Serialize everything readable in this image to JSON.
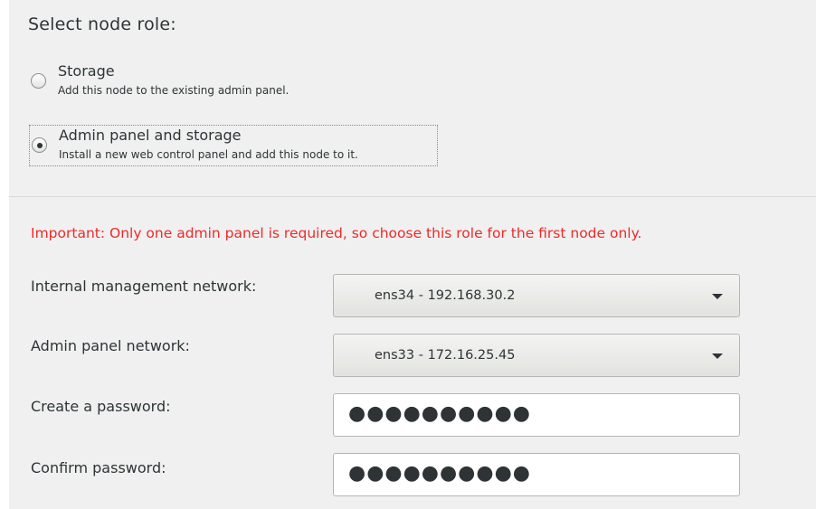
{
  "heading": "Select node role:",
  "roles": [
    {
      "title": "Storage",
      "description": "Add this node to the existing admin panel.",
      "checked": false
    },
    {
      "title": "Admin panel and storage",
      "description": "Install a new web control panel and add this node to it.",
      "checked": true
    }
  ],
  "important": "Important: Only one admin panel is required, so choose this role for the first node only.",
  "fields": {
    "internal_network": {
      "label": "Internal management network:",
      "value": "ens34 - 192.168.30.2"
    },
    "admin_network": {
      "label": "Admin panel network:",
      "value": "ens33 - 172.16.25.45"
    },
    "password": {
      "label": "Create a password:",
      "value": "●●●●●●●●●●"
    },
    "confirm_password": {
      "label": "Confirm password:",
      "value": "●●●●●●●●●●"
    }
  },
  "colors": {
    "important_text": "#ef2929",
    "panel_bg": "#f0f0f0"
  }
}
